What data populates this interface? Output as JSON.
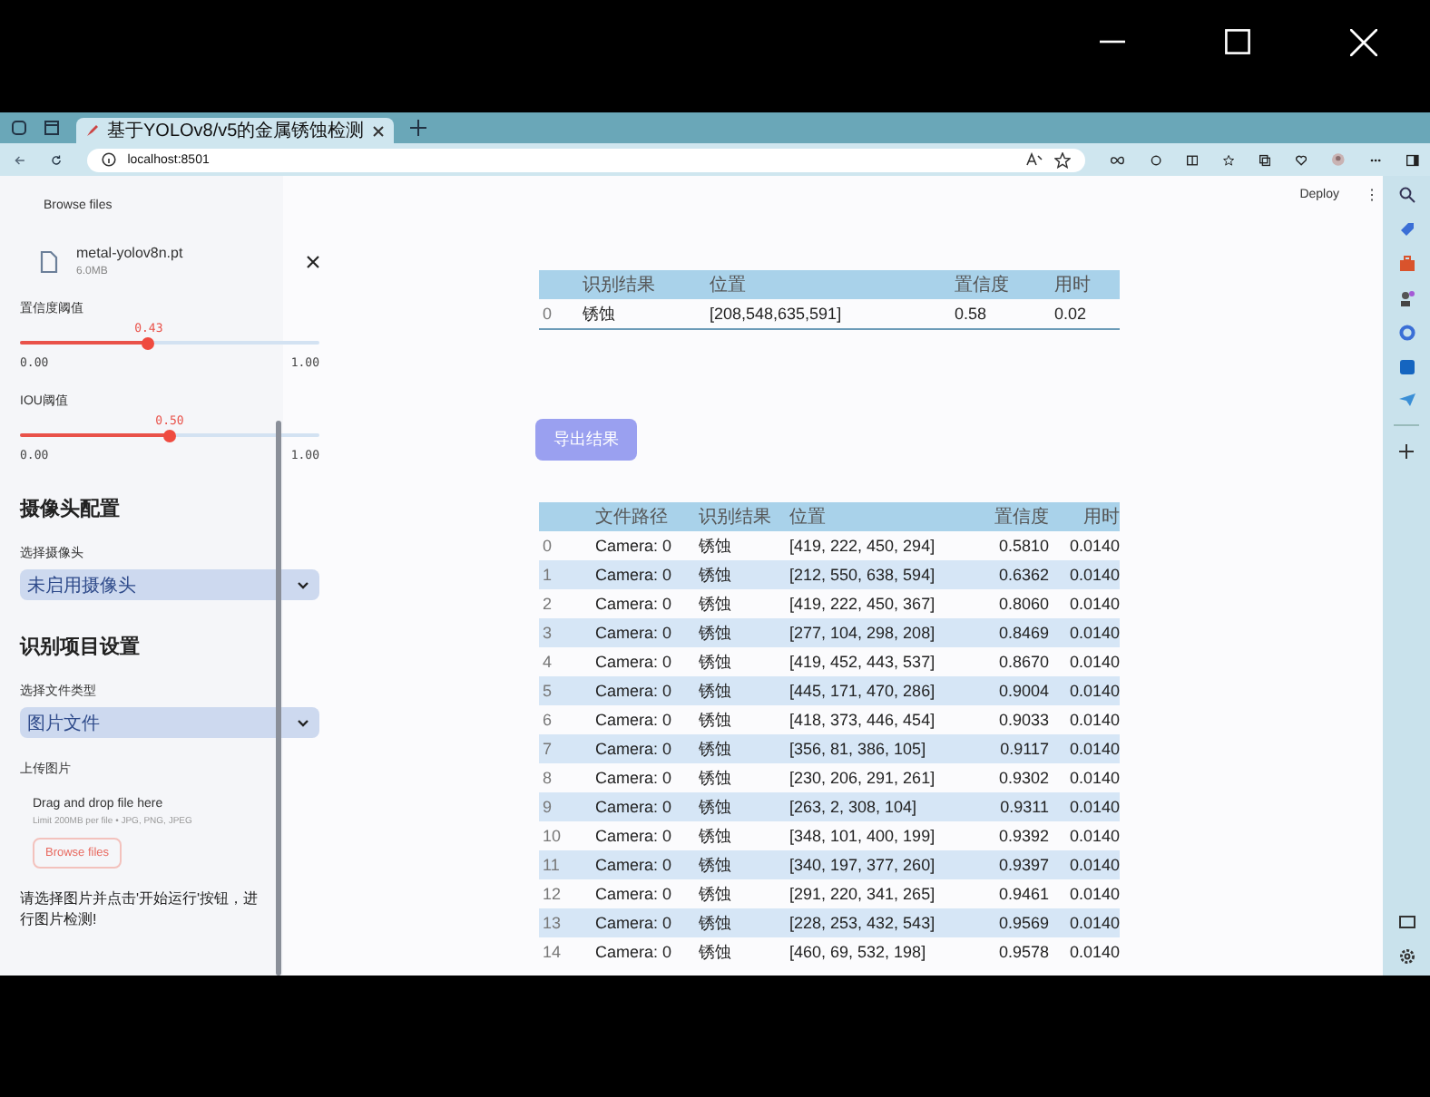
{
  "browser": {
    "tab_title": "基于YOLOv8/v5的金属锈蚀检测",
    "address": "localhost:8501"
  },
  "toolbar": {
    "deploy": "Deploy",
    "menu": "⋮"
  },
  "sidebar": {
    "top_button": "Browse files",
    "file": {
      "name": "metal-yolov8n.pt",
      "size": "6.0MB"
    },
    "sliders": [
      {
        "label": "置信度阈值",
        "value": "0.43",
        "level": 0.43,
        "min": "0.00",
        "max": "1.00"
      },
      {
        "label": "IOU阈值",
        "value": "0.50",
        "level": 0.5,
        "min": "0.00",
        "max": "1.00"
      }
    ],
    "sections": [
      {
        "heading": "摄像头配置",
        "label": "选择摄像头",
        "value": "未启用摄像头"
      },
      {
        "heading": "识别项目设置",
        "label": "选择文件类型",
        "value": "图片文件"
      }
    ],
    "upload": {
      "label": "上传图片",
      "drop_text": "Drag and drop file here",
      "limit": "Limit 200MB per file • JPG, PNG, JPEG",
      "button": "Browse files"
    },
    "hint": "请选择图片并点击'开始运行'按钮，进行图片检测!"
  },
  "result_table": {
    "columns": [
      "",
      "识别结果",
      "位置",
      "置信度",
      "用时"
    ],
    "rows": [
      [
        "0",
        "锈蚀",
        "[208,548,635,591]",
        "0.58",
        "0.02"
      ]
    ]
  },
  "export_button": "导出结果",
  "history_table": {
    "columns": [
      "",
      "文件路径",
      "识别结果",
      "位置",
      "置信度",
      "用时"
    ],
    "rows": [
      [
        "0",
        "Camera: 0",
        "锈蚀",
        "[419, 222, 450, 294]",
        "0.5810",
        "0.0140"
      ],
      [
        "1",
        "Camera: 0",
        "锈蚀",
        "[212, 550, 638, 594]",
        "0.6362",
        "0.0140"
      ],
      [
        "2",
        "Camera: 0",
        "锈蚀",
        "[419, 222, 450, 367]",
        "0.8060",
        "0.0140"
      ],
      [
        "3",
        "Camera: 0",
        "锈蚀",
        "[277, 104, 298, 208]",
        "0.8469",
        "0.0140"
      ],
      [
        "4",
        "Camera: 0",
        "锈蚀",
        "[419, 452, 443, 537]",
        "0.8670",
        "0.0140"
      ],
      [
        "5",
        "Camera: 0",
        "锈蚀",
        "[445, 171, 470, 286]",
        "0.9004",
        "0.0140"
      ],
      [
        "6",
        "Camera: 0",
        "锈蚀",
        "[418, 373, 446, 454]",
        "0.9033",
        "0.0140"
      ],
      [
        "7",
        "Camera: 0",
        "锈蚀",
        "[356, 81, 386, 105]",
        "0.9117",
        "0.0140"
      ],
      [
        "8",
        "Camera: 0",
        "锈蚀",
        "[230, 206, 291, 261]",
        "0.9302",
        "0.0140"
      ],
      [
        "9",
        "Camera: 0",
        "锈蚀",
        "[263, 2, 308, 104]",
        "0.9311",
        "0.0140"
      ],
      [
        "10",
        "Camera: 0",
        "锈蚀",
        "[348, 101, 400, 199]",
        "0.9392",
        "0.0140"
      ],
      [
        "11",
        "Camera: 0",
        "锈蚀",
        "[340, 197, 377, 260]",
        "0.9397",
        "0.0140"
      ],
      [
        "12",
        "Camera: 0",
        "锈蚀",
        "[291, 220, 341, 265]",
        "0.9461",
        "0.0140"
      ],
      [
        "13",
        "Camera: 0",
        "锈蚀",
        "[228, 253, 432, 543]",
        "0.9569",
        "0.0140"
      ],
      [
        "14",
        "Camera: 0",
        "锈蚀",
        "[460, 69, 532, 198]",
        "0.9578",
        "0.0140"
      ]
    ]
  }
}
